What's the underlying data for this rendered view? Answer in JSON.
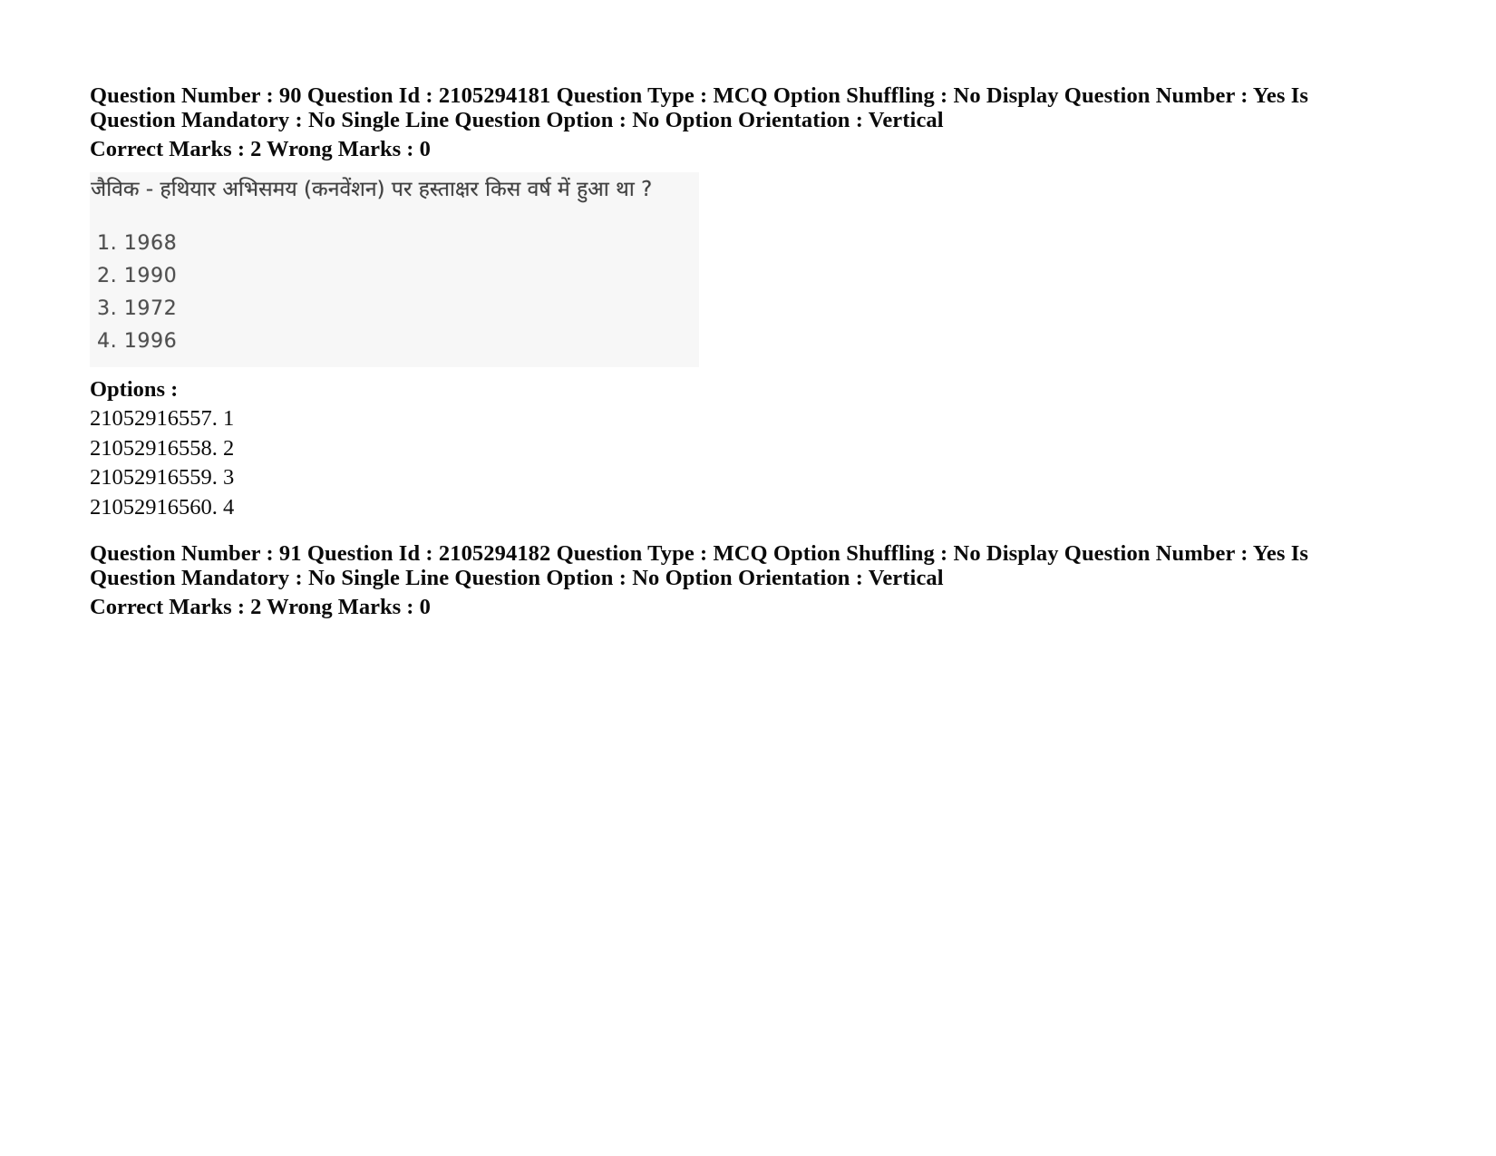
{
  "document": {
    "background_color": "#ffffff",
    "text_color": "#000000"
  },
  "questions": [
    {
      "meta_line_1": "Question Number : 90 Question Id : 2105294181 Question Type : MCQ Option Shuffling : No Display Question Number : Yes Is",
      "meta_line_2": "Question Mandatory : No Single Line Question Option : No Option Orientation : Vertical",
      "marks_line": "Correct Marks : 2 Wrong Marks : 0",
      "stem_text": "जैविक - हथियार अभिसमय (कनवेंशन) पर हस्ताक्षर किस वर्ष में हुआ था ?",
      "choices": [
        "1. 1968",
        "2. 1990",
        "3. 1972",
        "4. 1996"
      ],
      "options_heading": "Options :",
      "option_ids": [
        "21052916557. 1",
        "21052916558. 2",
        "21052916559. 3",
        "21052916560. 4"
      ]
    },
    {
      "meta_line_1": "Question Number : 91 Question Id : 2105294182 Question Type : MCQ Option Shuffling : No Display Question Number : Yes Is",
      "meta_line_2": "Question Mandatory : No Single Line Question Option : No Option Orientation : Vertical",
      "marks_line": "Correct Marks : 2 Wrong Marks : 0"
    }
  ]
}
